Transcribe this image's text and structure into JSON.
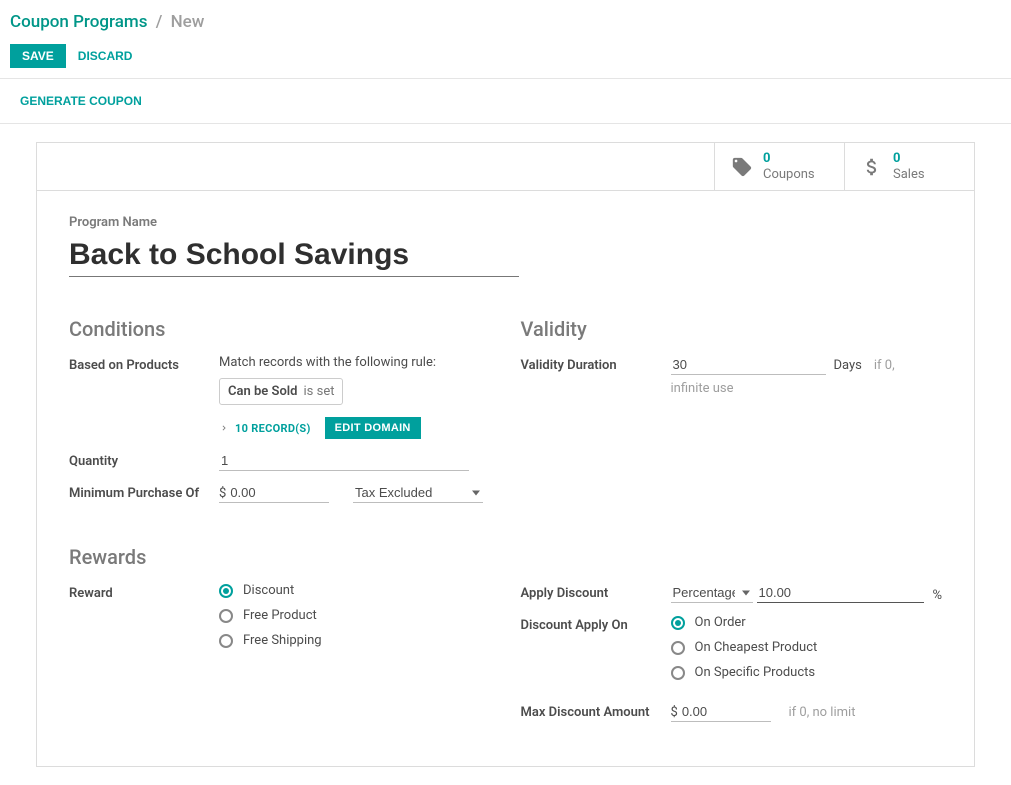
{
  "breadcrumb": {
    "parent": "Coupon Programs",
    "current": "New"
  },
  "buttons": {
    "save": "SAVE",
    "discard": "DISCARD",
    "generate": "GENERATE COUPON",
    "edit_domain": "EDIT DOMAIN"
  },
  "stats": {
    "coupons": {
      "value": "0",
      "label": "Coupons"
    },
    "sales": {
      "value": "0",
      "label": "Sales"
    }
  },
  "program": {
    "name_label": "Program Name",
    "name_value": "Back to School Savings"
  },
  "conditions": {
    "title": "Conditions",
    "based_on_label": "Based on Products",
    "match_text": "Match records with the following rule:",
    "tag_main": "Can be Sold",
    "tag_sub": "is set",
    "records_link": "10 RECORD(S)",
    "quantity_label": "Quantity",
    "quantity_value": "1",
    "min_purchase_label": "Minimum Purchase Of",
    "min_purchase_currency": "$",
    "min_purchase_value": "0.00",
    "tax_option": "Tax Excluded"
  },
  "validity": {
    "title": "Validity",
    "duration_label": "Validity Duration",
    "duration_value": "30",
    "duration_unit": "Days",
    "duration_help": "if 0, infinite use"
  },
  "rewards": {
    "title": "Rewards",
    "reward_label": "Reward",
    "options": {
      "discount": "Discount",
      "free_product": "Free Product",
      "free_shipping": "Free Shipping"
    },
    "selected": "discount",
    "apply_discount_label": "Apply Discount",
    "apply_discount_type": "Percentage",
    "apply_discount_value": "10.00",
    "apply_discount_unit": "%",
    "discount_apply_on_label": "Discount Apply On",
    "discount_apply_on_options": {
      "order": "On Order",
      "cheapest": "On Cheapest Product",
      "specific": "On Specific Products"
    },
    "discount_apply_on_selected": "order",
    "max_discount_label": "Max Discount Amount",
    "max_discount_currency": "$",
    "max_discount_value": "0.00",
    "max_discount_help": "if 0, no limit"
  }
}
